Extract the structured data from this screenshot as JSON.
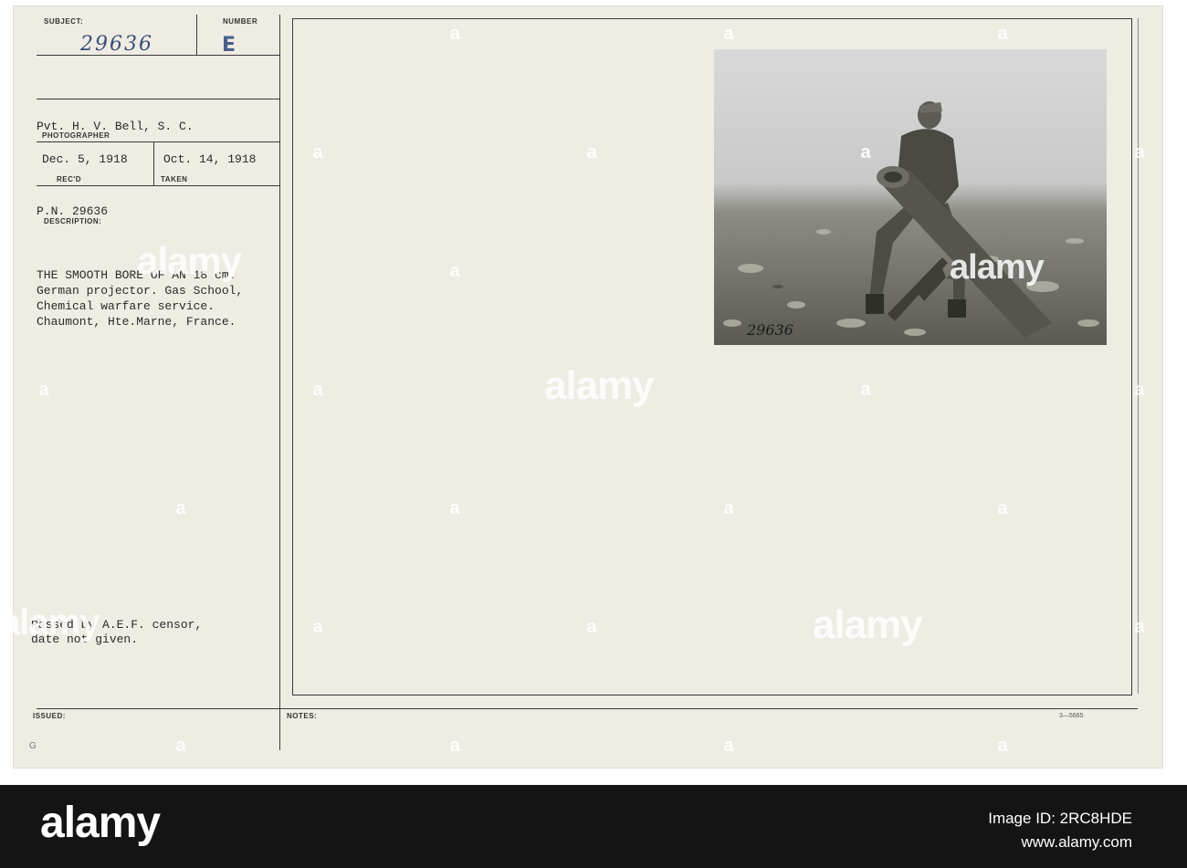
{
  "card": {
    "subject_label": "SUBJECT:",
    "subject_handwritten": "29636",
    "number_label": "NUMBER",
    "number_value": "E",
    "photographer_name": "Pvt. H. V. Bell, S. C.",
    "photographer_label": "PHOTOGRAPHER",
    "received_date": "Dec. 5, 1918",
    "received_label": "REC'D",
    "taken_date": "Oct. 14, 1918",
    "taken_label": "TAKEN",
    "pn": "P.N. 29636",
    "description_label": "DESCRIPTION:",
    "description_lines": [
      "THE SMOOTH BORE OF AN 18 cm.",
      "German projector. Gas School,",
      "Chemical warfare service.",
      "Chaumont, Hte.Marne, France."
    ],
    "censor_lines": [
      "Passed by A.E.F. censor,",
      "date not given."
    ],
    "issued_label": "ISSUED:",
    "notes_label": "NOTES:",
    "corner_mark": "G",
    "form_code": "3—5665",
    "photo_number": "29636"
  },
  "watermark": {
    "text": "alamy",
    "dot": "a"
  },
  "footer": {
    "logo": "alamy",
    "image_id": "Image ID: 2RC8HDE",
    "url": "www.alamy.com"
  }
}
